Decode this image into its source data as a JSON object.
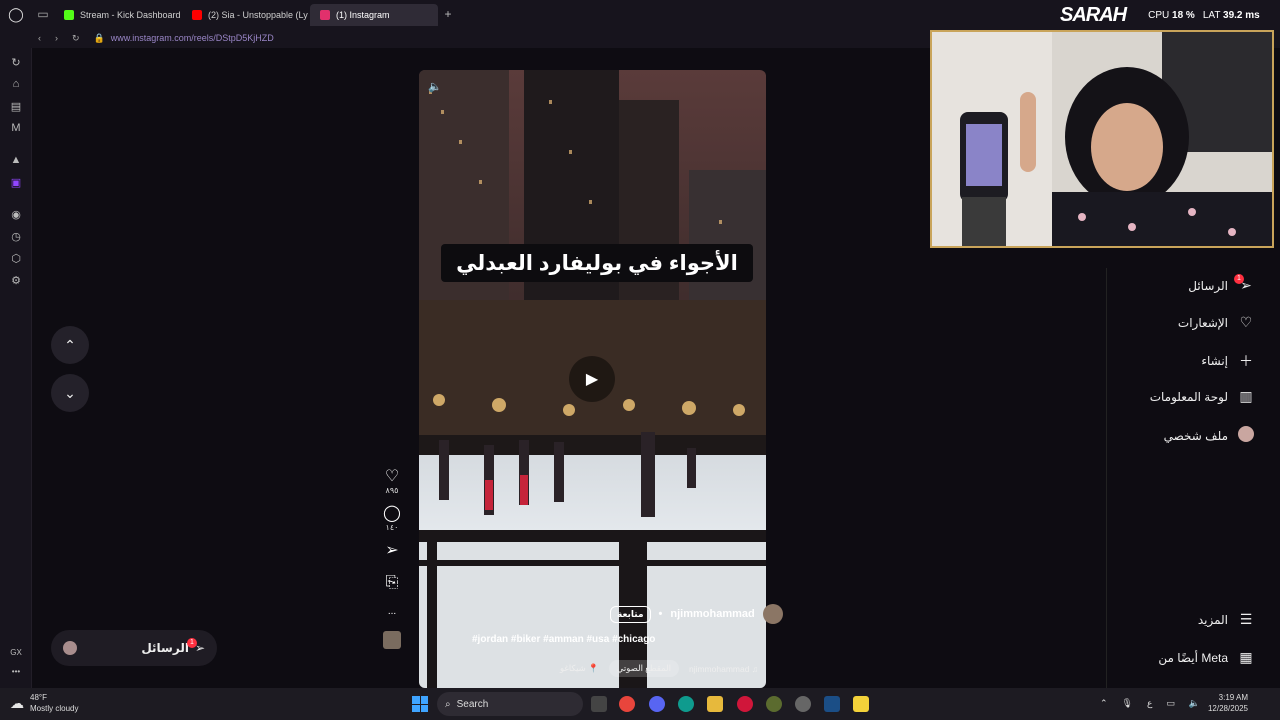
{
  "browser": {
    "tabs": [
      {
        "label": "Stream - Kick Dashboard",
        "color": "#53fc18"
      },
      {
        "label": "(2) Sia - Unstoppable (Ly",
        "color": "#ff0000"
      },
      {
        "label": "(1) Instagram",
        "color": "#e1306c"
      }
    ],
    "new_tab": "+",
    "url": "www.instagram.com/reels/DStpD5KjHZD",
    "gx_label": "GX"
  },
  "reel": {
    "caption_overlay": "الأجواء في بوليفارد العبدلي",
    "author": "njimmohammad",
    "follow_label": "متابعة",
    "hashtags": "#jordan #biker #amman #usa #chicago",
    "location": "شيكاغو",
    "audio_label": "المقطع الصوتي",
    "audio_author": "njimmohammad",
    "likes": "٨٩٥",
    "comments": "١٤٠",
    "more": "..."
  },
  "menu": {
    "items": [
      {
        "label": "الرسائل",
        "icon": "send-icon"
      },
      {
        "label": "الإشعارات",
        "icon": "heart-icon"
      },
      {
        "label": "إنشاء",
        "icon": "plus-icon"
      },
      {
        "label": "لوحة المعلومات",
        "icon": "dashboard-icon"
      },
      {
        "label": "ملف شخصي",
        "icon": "avatar-icon"
      }
    ],
    "more_label": "المزيد",
    "meta_label": "أيضًا من Meta",
    "messages_badge": "1"
  },
  "messages_pill": {
    "label": "الرسائل",
    "badge": "1"
  },
  "overlay": {
    "brand": "SARAH",
    "cpu_label": "CPU",
    "cpu_value": "18 %",
    "lat_label": "LAT",
    "lat_value": "39.2 ms"
  },
  "taskbar": {
    "temperature": "48°F",
    "weather": "Mostly cloudy",
    "search_placeholder": "Search",
    "time": "3:19 AM",
    "date": "12/28/2025",
    "lang": "ع"
  }
}
